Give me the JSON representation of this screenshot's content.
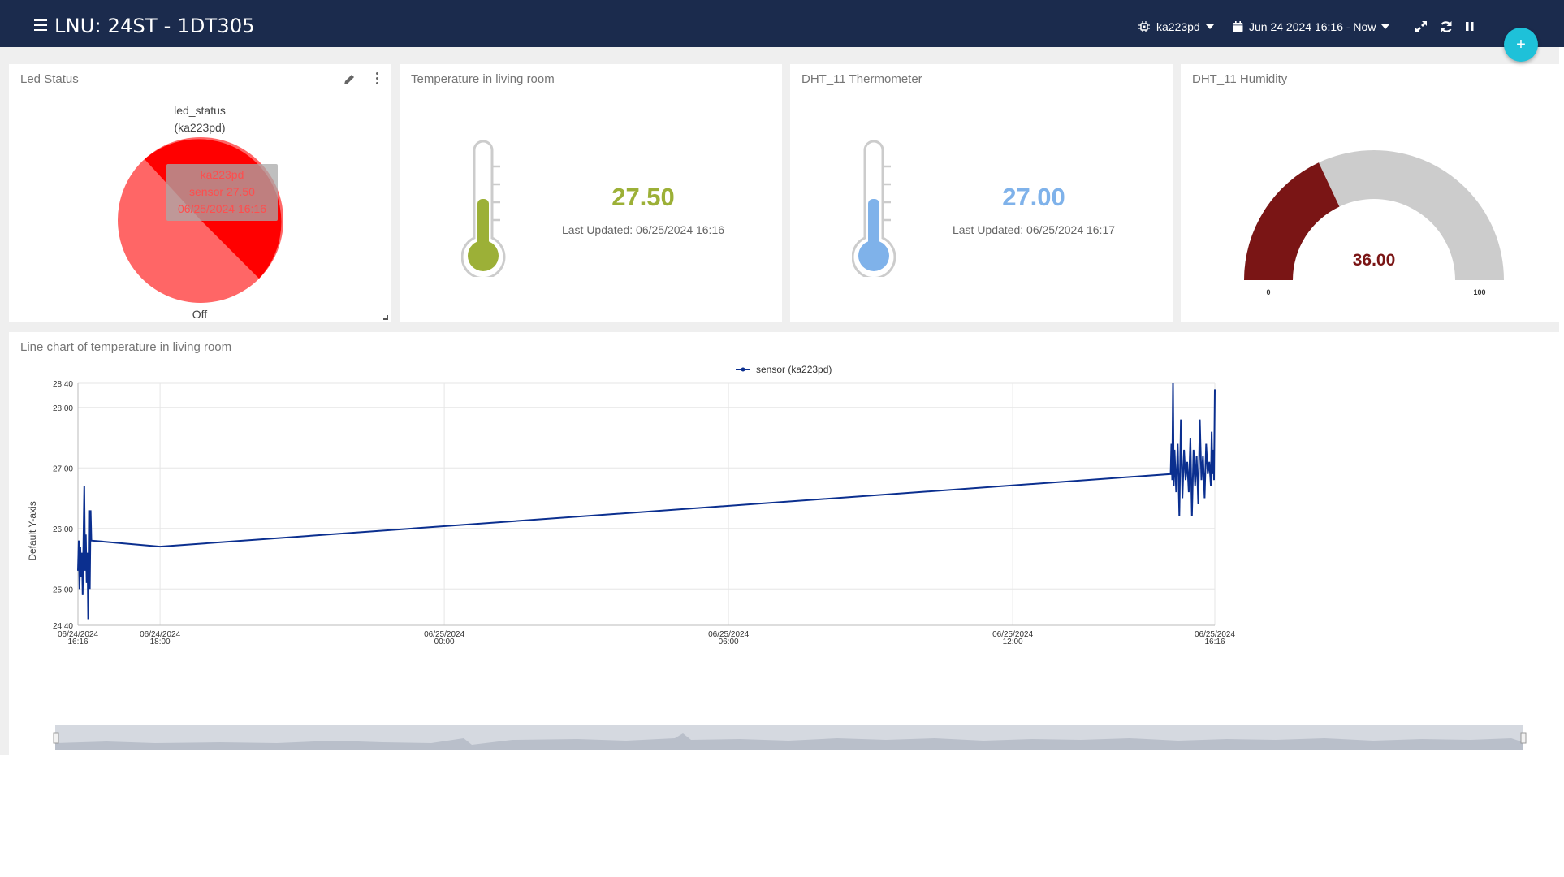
{
  "header": {
    "title": "LNU: 24ST - 1DT305",
    "device": "ka223pd",
    "time_range": "Jun 24 2024 16:16 - Now",
    "add_label": "+"
  },
  "colors": {
    "header_bg": "#1b2b4d",
    "accent": "#1ec1d9",
    "series": "#0b2f8f"
  },
  "widgets": {
    "led": {
      "title": "Led Status",
      "chart_title": "led_status",
      "chart_subtitle": "(ka223pd)",
      "tooltip_device": "ka223pd",
      "tooltip_value": "sensor 27.50",
      "tooltip_time": "06/25/2024 16:16",
      "state_label": "Off"
    },
    "temp_room": {
      "title": "Temperature in living room",
      "value": "27.50",
      "updated": "Last Updated: 06/25/2024 16:16",
      "fill_level": 0.33,
      "color": "#9cb037"
    },
    "dht_thermo": {
      "title": "DHT_11 Thermometer",
      "value": "27.00",
      "updated": "Last Updated: 06/25/2024 16:17",
      "fill_level": 0.33,
      "color": "#7fb2ea"
    },
    "dht_humidity": {
      "title": "DHT_11 Humidity",
      "value": "36.00",
      "min": "0",
      "max": "100",
      "color": "#7a1515"
    },
    "line": {
      "title": "Line chart of temperature in living room"
    }
  },
  "chart_data": {
    "type": "line",
    "title": "",
    "legend": "sensor (ka223pd)",
    "ylabel": "Default Y-axis",
    "ylim": [
      24.4,
      28.4
    ],
    "y_ticks": [
      "28.40",
      "28.00",
      "27.00",
      "26.00",
      "25.00",
      "24.40"
    ],
    "x_ticks": [
      {
        "date": "06/24/2024",
        "time": "16:16"
      },
      {
        "date": "06/24/2024",
        "time": "18:00"
      },
      {
        "date": "06/25/2024",
        "time": "00:00"
      },
      {
        "date": "06/25/2024",
        "time": "06:00"
      },
      {
        "date": "06/25/2024",
        "time": "12:00"
      },
      {
        "date": "06/25/2024",
        "time": "16:16"
      }
    ],
    "series": [
      {
        "name": "sensor (ka223pd)",
        "points": [
          [
            "06/24/2024 16:16",
            25.3
          ],
          [
            "06/24/2024 16:17",
            25.8
          ],
          [
            "06/24/2024 16:18",
            25.0
          ],
          [
            "06/24/2024 16:19",
            25.7
          ],
          [
            "06/24/2024 16:20",
            25.2
          ],
          [
            "06/24/2024 16:21",
            25.6
          ],
          [
            "06/24/2024 16:22",
            24.9
          ],
          [
            "06/24/2024 16:23",
            25.8
          ],
          [
            "06/24/2024 16:24",
            26.7
          ],
          [
            "06/24/2024 16:25",
            25.3
          ],
          [
            "06/24/2024 16:26",
            25.9
          ],
          [
            "06/24/2024 16:27",
            25.1
          ],
          [
            "06/24/2024 16:28",
            25.6
          ],
          [
            "06/24/2024 16:29",
            24.5
          ],
          [
            "06/24/2024 16:30",
            26.3
          ],
          [
            "06/24/2024 16:31",
            25.0
          ],
          [
            "06/24/2024 16:32",
            26.3
          ],
          [
            "06/24/2024 16:33",
            25.8
          ],
          [
            "06/24/2024 18:00",
            25.7
          ],
          [
            "06/25/2024 15:20",
            26.9
          ],
          [
            "06/25/2024 15:21",
            27.4
          ],
          [
            "06/25/2024 15:22",
            26.8
          ],
          [
            "06/25/2024 15:23",
            28.4
          ],
          [
            "06/25/2024 15:24",
            26.7
          ],
          [
            "06/25/2024 15:25",
            27.3
          ],
          [
            "06/25/2024 15:27",
            26.6
          ],
          [
            "06/25/2024 15:29",
            27.4
          ],
          [
            "06/25/2024 15:31",
            26.2
          ],
          [
            "06/25/2024 15:33",
            27.8
          ],
          [
            "06/25/2024 15:35",
            26.5
          ],
          [
            "06/25/2024 15:37",
            27.3
          ],
          [
            "06/25/2024 15:39",
            26.8
          ],
          [
            "06/25/2024 15:41",
            27.1
          ],
          [
            "06/25/2024 15:43",
            26.6
          ],
          [
            "06/25/2024 15:45",
            27.5
          ],
          [
            "06/25/2024 15:47",
            26.2
          ],
          [
            "06/25/2024 15:49",
            27.3
          ],
          [
            "06/25/2024 15:51",
            26.7
          ],
          [
            "06/25/2024 15:53",
            27.2
          ],
          [
            "06/25/2024 15:55",
            26.4
          ],
          [
            "06/25/2024 15:57",
            27.8
          ],
          [
            "06/25/2024 15:59",
            26.8
          ],
          [
            "06/25/2024 16:01",
            27.2
          ],
          [
            "06/25/2024 16:03",
            26.5
          ],
          [
            "06/25/2024 16:05",
            27.4
          ],
          [
            "06/25/2024 16:07",
            26.9
          ],
          [
            "06/25/2024 16:09",
            27.1
          ],
          [
            "06/25/2024 16:11",
            26.7
          ],
          [
            "06/25/2024 16:12",
            27.6
          ],
          [
            "06/25/2024 16:13",
            26.9
          ],
          [
            "06/25/2024 16:14",
            27.3
          ],
          [
            "06/25/2024 16:15",
            26.8
          ],
          [
            "06/25/2024 16:16",
            28.3
          ]
        ]
      }
    ],
    "grid": true,
    "legend_position": "top-center"
  }
}
